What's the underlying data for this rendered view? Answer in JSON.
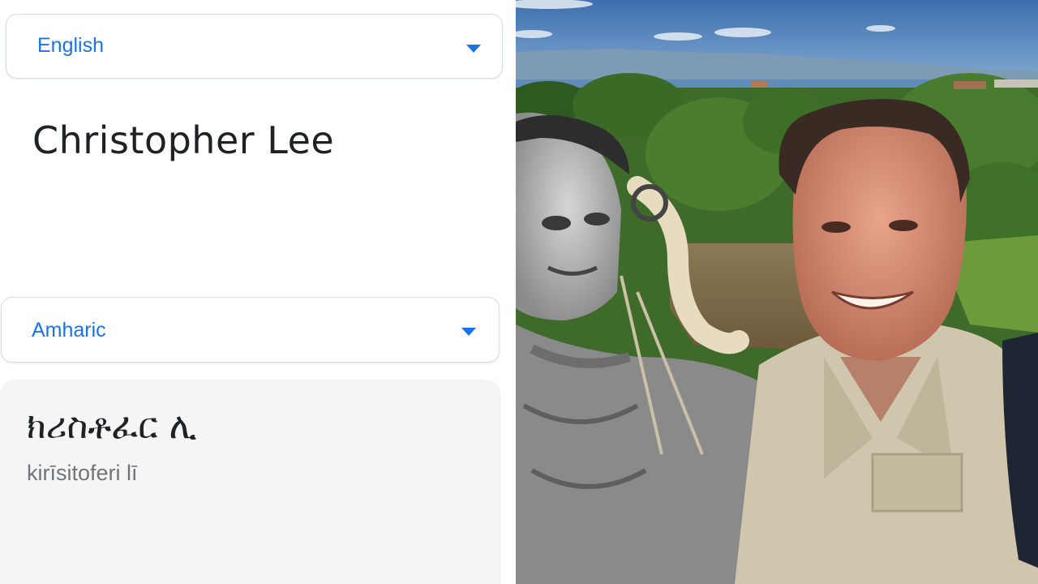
{
  "translator": {
    "source_language": "English",
    "source_text": "Christopher Lee",
    "target_language": "Amharic",
    "translation": "ክሪስቶፈር ሊ",
    "transliteration": "kirīsitoferi lī",
    "dropdown_icon": "caret-down-icon",
    "accent_color": "#1a73e8"
  },
  "photo": {
    "description_icon": "photo-illustration"
  }
}
